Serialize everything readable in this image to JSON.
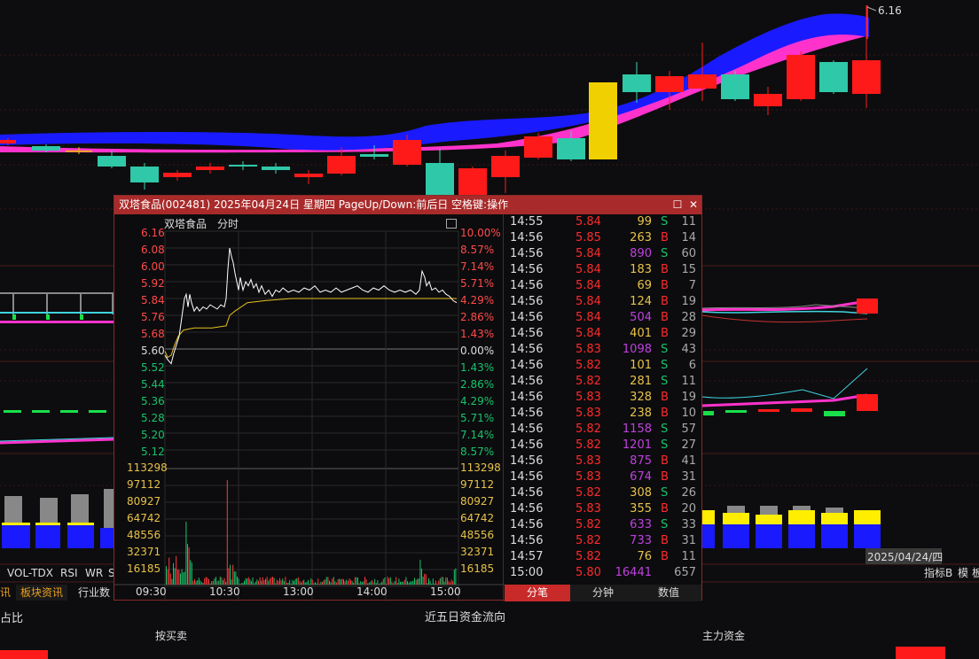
{
  "main_chart": {
    "last_price_label": "6.16",
    "date_label": "2025/04/24/四"
  },
  "indicator_tabs": [
    "VOL-TDX",
    "RSI",
    "WR",
    "S"
  ],
  "bottom_tabs": [
    {
      "label": "讯",
      "active": true
    },
    {
      "label": "板块资讯",
      "active": true
    },
    {
      "label": "行业数"
    }
  ],
  "right_labels": {
    "indicator_b": "指标B",
    "mode": "模",
    "extra": "板"
  },
  "bottom_panel": {
    "left_label": "占比",
    "center_title": "近五日资金流向",
    "buy_sell": "按买卖",
    "main_funds": "主力资金"
  },
  "popup": {
    "title": "双塔食品(002481)  2025年04月24日 星期四  PageUp/Down:前后日  空格键:操作",
    "stock_name": "双塔食品",
    "chart_mode": "分时",
    "price_levels": [
      "6.16",
      "6.08",
      "6.00",
      "5.92",
      "5.84",
      "5.76",
      "5.68",
      "5.60",
      "5.52",
      "5.44",
      "5.36",
      "5.28",
      "5.20",
      "5.12"
    ],
    "pct_levels": [
      "10.00%",
      "8.57%",
      "7.14%",
      "5.71%",
      "4.29%",
      "2.86%",
      "1.43%",
      "0.00%",
      "1.43%",
      "2.86%",
      "4.29%",
      "5.71%",
      "7.14%",
      "8.57%"
    ],
    "volume_levels": [
      "113298",
      "97112",
      "80927",
      "64742",
      "48556",
      "32371",
      "16185"
    ],
    "time_labels": [
      "09:30",
      "10:30",
      "13:00",
      "14:00",
      "15:00"
    ],
    "ticks": [
      {
        "time": "14:55",
        "price": "5.84",
        "vol": "99",
        "side": "S",
        "count": "11"
      },
      {
        "time": "14:56",
        "price": "5.85",
        "vol": "263",
        "side": "B",
        "count": "14"
      },
      {
        "time": "14:56",
        "price": "5.84",
        "vol": "890",
        "side": "S",
        "count": "60"
      },
      {
        "time": "14:56",
        "price": "5.84",
        "vol": "183",
        "side": "B",
        "count": "15"
      },
      {
        "time": "14:56",
        "price": "5.84",
        "vol": "69",
        "side": "B",
        "count": "7"
      },
      {
        "time": "14:56",
        "price": "5.84",
        "vol": "124",
        "side": "B",
        "count": "19"
      },
      {
        "time": "14:56",
        "price": "5.84",
        "vol": "504",
        "side": "B",
        "count": "28"
      },
      {
        "time": "14:56",
        "price": "5.84",
        "vol": "401",
        "side": "B",
        "count": "29"
      },
      {
        "time": "14:56",
        "price": "5.83",
        "vol": "1098",
        "side": "S",
        "count": "43"
      },
      {
        "time": "14:56",
        "price": "5.82",
        "vol": "101",
        "side": "S",
        "count": "6"
      },
      {
        "time": "14:56",
        "price": "5.82",
        "vol": "281",
        "side": "S",
        "count": "11"
      },
      {
        "time": "14:56",
        "price": "5.83",
        "vol": "328",
        "side": "B",
        "count": "19"
      },
      {
        "time": "14:56",
        "price": "5.83",
        "vol": "238",
        "side": "B",
        "count": "10"
      },
      {
        "time": "14:56",
        "price": "5.82",
        "vol": "1158",
        "side": "S",
        "count": "57"
      },
      {
        "time": "14:56",
        "price": "5.82",
        "vol": "1201",
        "side": "S",
        "count": "27"
      },
      {
        "time": "14:56",
        "price": "5.83",
        "vol": "875",
        "side": "B",
        "count": "41"
      },
      {
        "time": "14:56",
        "price": "5.83",
        "vol": "674",
        "side": "B",
        "count": "31"
      },
      {
        "time": "14:56",
        "price": "5.82",
        "vol": "308",
        "side": "S",
        "count": "26"
      },
      {
        "time": "14:56",
        "price": "5.83",
        "vol": "355",
        "side": "B",
        "count": "20"
      },
      {
        "time": "14:56",
        "price": "5.82",
        "vol": "633",
        "side": "S",
        "count": "33"
      },
      {
        "time": "14:56",
        "price": "5.82",
        "vol": "733",
        "side": "B",
        "count": "31"
      },
      {
        "time": "14:57",
        "price": "5.82",
        "vol": "76",
        "side": "B",
        "count": "11"
      },
      {
        "time": "15:00",
        "price": "5.80",
        "vol": "16441",
        "side": "",
        "count": "657"
      }
    ],
    "tabs": [
      "分笔",
      "分钟",
      "数值"
    ],
    "active_tab": 0
  },
  "colors": {
    "up": "#ff2a2a",
    "down": "#19c26b",
    "neutral": "#dddddd",
    "vol_yellow": "#e8c24a",
    "vol_purple": "#c040e0",
    "accent": "#a92a2a"
  }
}
